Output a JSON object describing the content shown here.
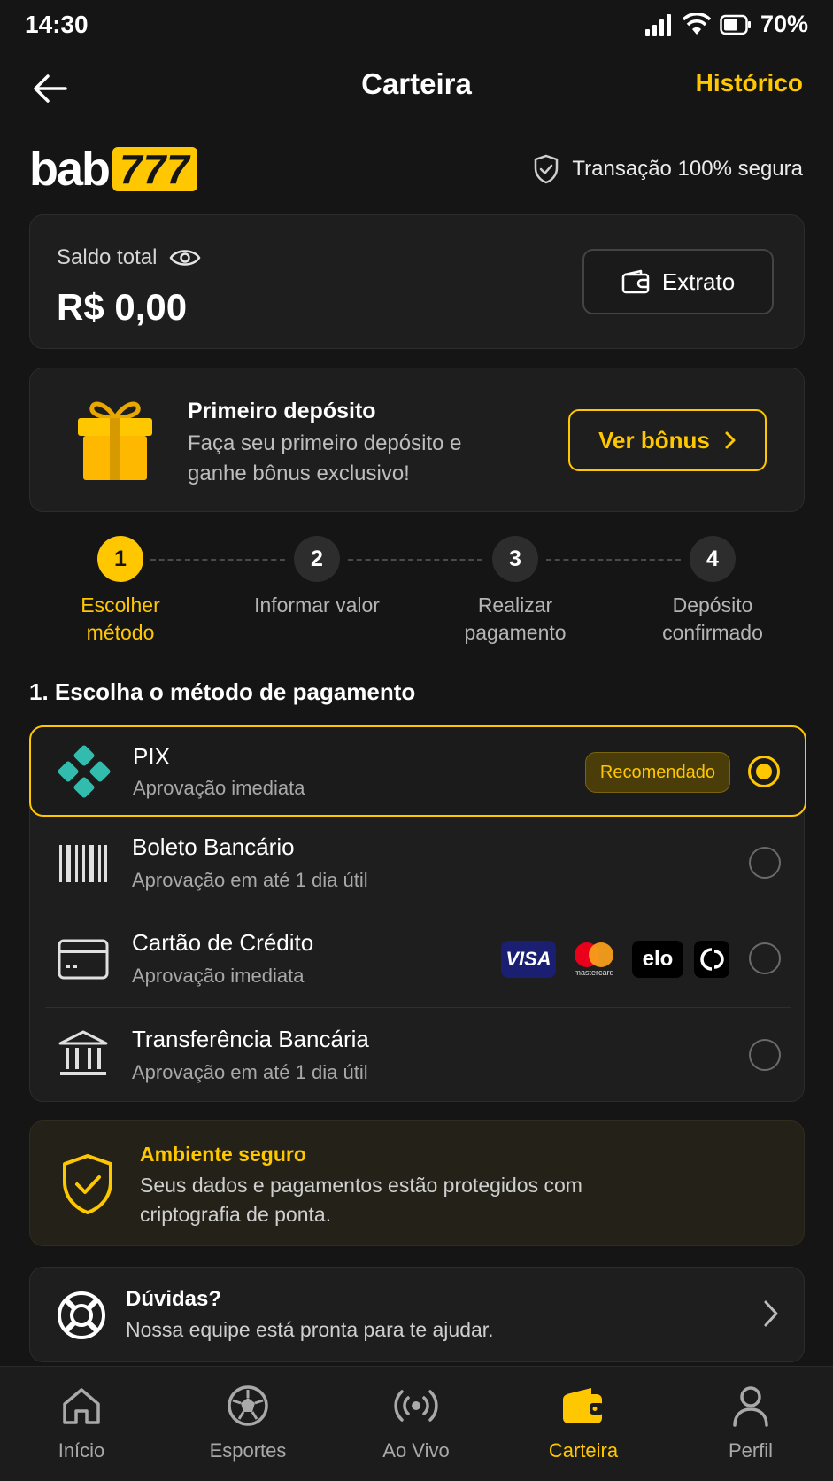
{
  "status_bar": {
    "time": "14:30",
    "battery": "70%"
  },
  "header": {
    "title": "Carteira",
    "history_link": "Histórico"
  },
  "brand": {
    "logo_text": "bab",
    "logo_number": "777",
    "secure_text": "Transação 100% segura"
  },
  "balance": {
    "label": "Saldo total",
    "value": "R$ 0,00",
    "statement_button": "Extrato"
  },
  "bonus": {
    "title": "Primeiro depósito",
    "text": "Faça seu primeiro depósito e ganhe bônus exclusivo!",
    "button": "Ver bônus"
  },
  "steps": [
    {
      "number": "1",
      "label": "Escolher método",
      "active": true
    },
    {
      "number": "2",
      "label": "Informar valor",
      "active": false
    },
    {
      "number": "3",
      "label": "Realizar pagamento",
      "active": false
    },
    {
      "number": "4",
      "label": "Depósito confirmado",
      "active": false
    }
  ],
  "section_title": "1. Escolha o método de pagamento",
  "methods": [
    {
      "title": "PIX",
      "subtitle": "Aprovação imediata",
      "badge": "Recomendado",
      "selected": true,
      "icon": "pix-icon"
    },
    {
      "title": "Boleto Bancário",
      "subtitle": "Aprovação em até 1 dia útil",
      "selected": false,
      "icon": "barcode-icon"
    },
    {
      "title": "Cartão de Crédito",
      "subtitle": "Aprovação imediata",
      "selected": false,
      "icon": "credit-card-icon",
      "brands": [
        "VISA",
        "mastercard",
        "elo",
        "diners"
      ]
    },
    {
      "title": "Transferência Bancária",
      "subtitle": "Aprovação em até 1 dia útil",
      "selected": false,
      "icon": "bank-icon"
    }
  ],
  "secure_box": {
    "title": "Ambiente seguro",
    "text": "Seus dados e pagamentos estão protegidos com criptografia de ponta."
  },
  "help": {
    "title": "Dúvidas?",
    "text": "Nossa equipe está pronta para te ajudar."
  },
  "bottom_nav": [
    {
      "label": "Início",
      "icon": "home-icon",
      "active": false
    },
    {
      "label": "Esportes",
      "icon": "soccer-ball-icon",
      "active": false
    },
    {
      "label": "Ao Vivo",
      "icon": "live-broadcast-icon",
      "active": false
    },
    {
      "label": "Carteira",
      "icon": "wallet-icon",
      "active": true
    },
    {
      "label": "Perfil",
      "icon": "user-icon",
      "active": false
    }
  ],
  "colors": {
    "accent": "#FFC700",
    "background": "#151515",
    "card": "#1e1e1e",
    "pix": "#32BCAD"
  }
}
